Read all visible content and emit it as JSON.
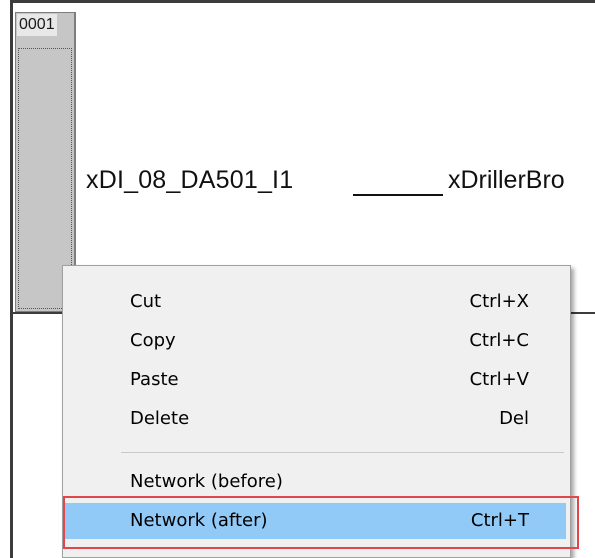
{
  "network": {
    "number": "0001",
    "contact_variable": "xDI_08_DA501_I1",
    "coil_variable": "xDrillerBro"
  },
  "context_menu": {
    "items": [
      {
        "label": "Cut",
        "shortcut": "Ctrl+X"
      },
      {
        "label": "Copy",
        "shortcut": "Ctrl+C"
      },
      {
        "label": "Paste",
        "shortcut": "Ctrl+V"
      },
      {
        "label": "Delete",
        "shortcut": "Del"
      },
      {
        "label": "Network (before)",
        "shortcut": ""
      },
      {
        "label": "Network (after)",
        "shortcut": "Ctrl+T"
      }
    ],
    "highlighted_item": "Network (after)",
    "highlight_color": "#91c9f7",
    "annotation_color": "#e0474c"
  }
}
